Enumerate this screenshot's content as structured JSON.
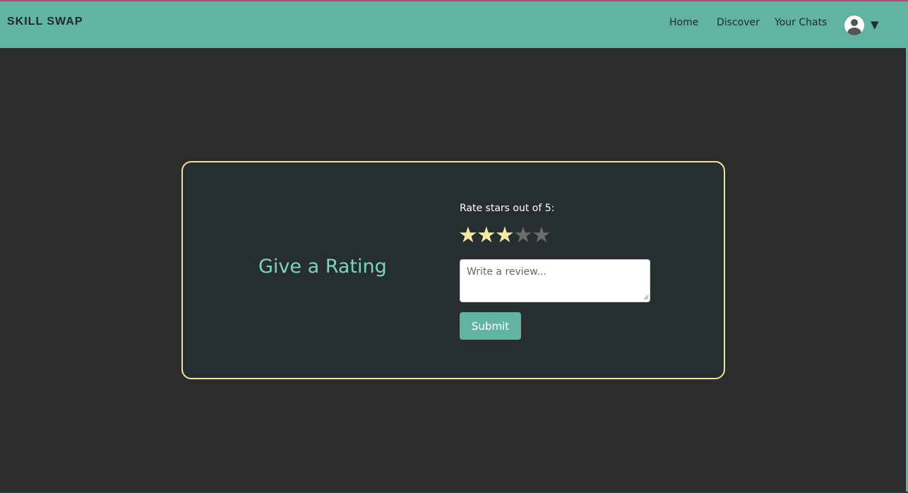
{
  "header": {
    "brand": "SKILL SWAP",
    "nav": {
      "home": "Home",
      "discover": "Discover",
      "chats": "Your Chats"
    },
    "avatar_icon": "user-circle-icon",
    "dropdown_caret": "▼"
  },
  "rating_card": {
    "title": "Give a Rating",
    "rate_label": "Rate stars out of 5:",
    "star_glyph": "★",
    "rating": 3,
    "max_rating": 5,
    "review_placeholder": "Write a review...",
    "review_value": "",
    "submit_label": "Submit"
  },
  "colors": {
    "header_bg": "#63b3a3",
    "page_bg": "#2c2c2c",
    "card_bg": "#262e2f",
    "card_border": "#efe59a",
    "title": "#7fd1c4",
    "star_filled": "#f4eaa6",
    "star_empty": "#6b6b6b",
    "button_bg": "#63b3a3"
  }
}
